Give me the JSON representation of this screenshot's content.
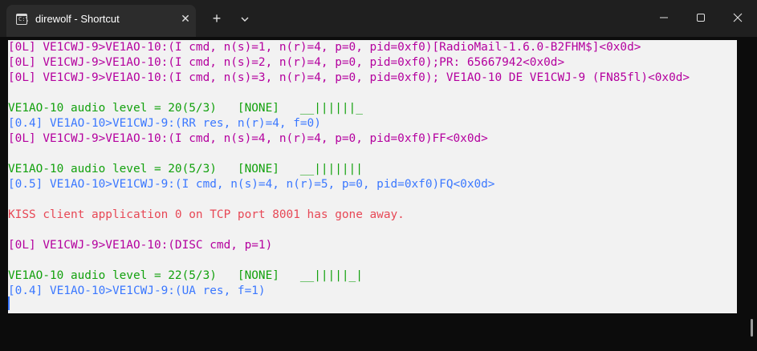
{
  "window": {
    "tab_title": "direwolf - Shortcut",
    "tab_icon": "terminal-icon",
    "new_tab_label": "+",
    "close_tab_label": "✕",
    "minimize_label": "—",
    "maximize_label": "☐",
    "close_label": "✕"
  },
  "colors": {
    "magenta": "#b4009e",
    "green": "#13a10e",
    "blue": "#3b78ff",
    "red": "#e74856",
    "console_bg": "#f2f2f2"
  },
  "console_lines": [
    {
      "text": "[0L] VE1CWJ-9>VE1AO-10:(I cmd, n(s)=1, n(r)=4, p=0, pid=0xf0)[RadioMail-1.6.0-B2FHM$]<0x0d>",
      "color": "magenta"
    },
    {
      "text": "[0L] VE1CWJ-9>VE1AO-10:(I cmd, n(s)=2, n(r)=4, p=0, pid=0xf0);PR: 65667942<0x0d>",
      "color": "magenta"
    },
    {
      "text": "[0L] VE1CWJ-9>VE1AO-10:(I cmd, n(s)=3, n(r)=4, p=0, pid=0xf0); VE1AO-10 DE VE1CWJ-9 (FN85fl)<0x0d>",
      "color": "magenta"
    },
    {
      "text": "",
      "color": "green"
    },
    {
      "text": "VE1AO-10 audio level = 20(5/3)   [NONE]   __||||||_",
      "color": "green"
    },
    {
      "text": "[0.4] VE1AO-10>VE1CWJ-9:(RR res, n(r)=4, f=0)",
      "color": "blue"
    },
    {
      "text": "[0L] VE1CWJ-9>VE1AO-10:(I cmd, n(s)=4, n(r)=4, p=0, pid=0xf0)FF<0x0d>",
      "color": "magenta"
    },
    {
      "text": "",
      "color": "green"
    },
    {
      "text": "VE1AO-10 audio level = 20(5/3)   [NONE]   __|||||||",
      "color": "green"
    },
    {
      "text": "[0.5] VE1AO-10>VE1CWJ-9:(I cmd, n(s)=4, n(r)=5, p=0, pid=0xf0)FQ<0x0d>",
      "color": "blue"
    },
    {
      "text": "",
      "color": "red"
    },
    {
      "text": "KISS client application 0 on TCP port 8001 has gone away.",
      "color": "red"
    },
    {
      "text": "",
      "color": "magenta"
    },
    {
      "text": "[0L] VE1CWJ-9>VE1AO-10:(DISC cmd, p=1)",
      "color": "magenta"
    },
    {
      "text": "",
      "color": "green"
    },
    {
      "text": "VE1AO-10 audio level = 22(5/3)   [NONE]   __|||||_|",
      "color": "green"
    },
    {
      "text": "[0.4] VE1AO-10>VE1CWJ-9:(UA res, f=1)",
      "color": "blue"
    }
  ]
}
